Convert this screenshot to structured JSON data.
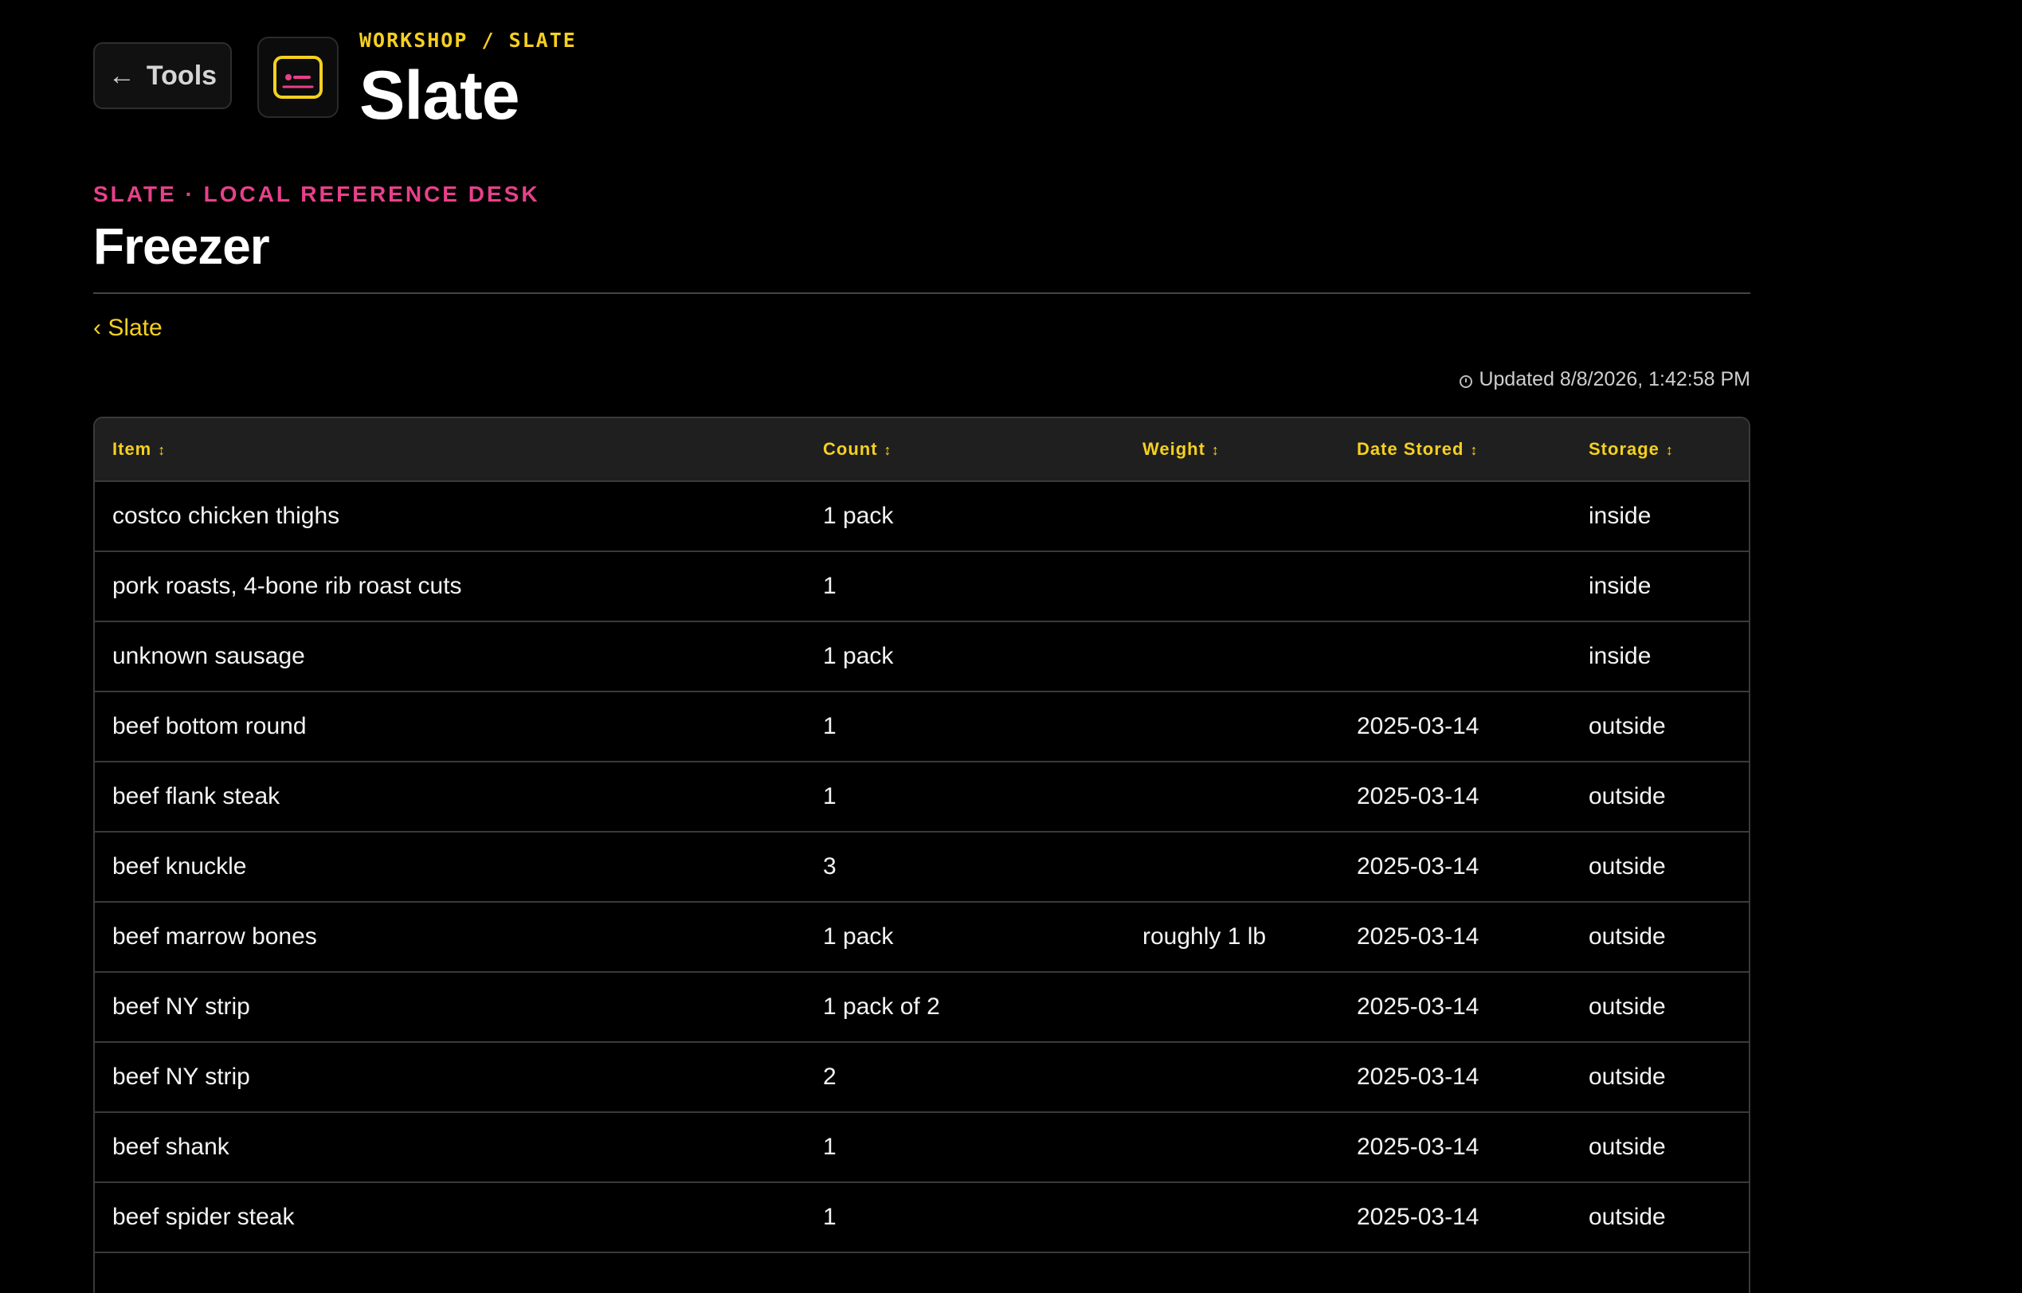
{
  "header": {
    "back_label": "Tools",
    "breadcrumb": "WORKSHOP / SLATE",
    "app_title": "Slate"
  },
  "section": {
    "eyebrow": "SLATE · LOCAL REFERENCE DESK",
    "title": "Freezer",
    "back_link": "‹ Slate",
    "updated": "Updated 8/8/2026, 1:42:58 PM"
  },
  "colors": {
    "accent_yellow": "#f5d020",
    "accent_pink": "#e8408a",
    "background": "#000000"
  },
  "table": {
    "columns": [
      {
        "label": "Item",
        "sort_icon": "↕"
      },
      {
        "label": "Count",
        "sort_icon": "↕"
      },
      {
        "label": "Weight",
        "sort_icon": "↕"
      },
      {
        "label": "Date Stored",
        "sort_icon": "↕"
      },
      {
        "label": "Storage",
        "sort_icon": "↕"
      }
    ],
    "rows": [
      {
        "item": "costco chicken thighs",
        "count": "1 pack",
        "weight": "",
        "date": "",
        "storage": "inside"
      },
      {
        "item": "pork roasts, 4-bone rib roast cuts",
        "count": "1",
        "weight": "",
        "date": "",
        "storage": "inside"
      },
      {
        "item": "unknown sausage",
        "count": "1 pack",
        "weight": "",
        "date": "",
        "storage": "inside"
      },
      {
        "item": "beef bottom round",
        "count": "1",
        "weight": "",
        "date": "2025-03-14",
        "storage": "outside"
      },
      {
        "item": "beef flank steak",
        "count": "1",
        "weight": "",
        "date": "2025-03-14",
        "storage": "outside"
      },
      {
        "item": "beef knuckle",
        "count": "3",
        "weight": "",
        "date": "2025-03-14",
        "storage": "outside"
      },
      {
        "item": "beef marrow bones",
        "count": "1 pack",
        "weight": "roughly 1 lb",
        "date": "2025-03-14",
        "storage": "outside"
      },
      {
        "item": "beef NY strip",
        "count": "1 pack of 2",
        "weight": "",
        "date": "2025-03-14",
        "storage": "outside"
      },
      {
        "item": "beef NY strip",
        "count": "2",
        "weight": "",
        "date": "2025-03-14",
        "storage": "outside"
      },
      {
        "item": "beef shank",
        "count": "1",
        "weight": "",
        "date": "2025-03-14",
        "storage": "outside"
      },
      {
        "item": "beef spider steak",
        "count": "1",
        "weight": "",
        "date": "2025-03-14",
        "storage": "outside"
      }
    ]
  }
}
